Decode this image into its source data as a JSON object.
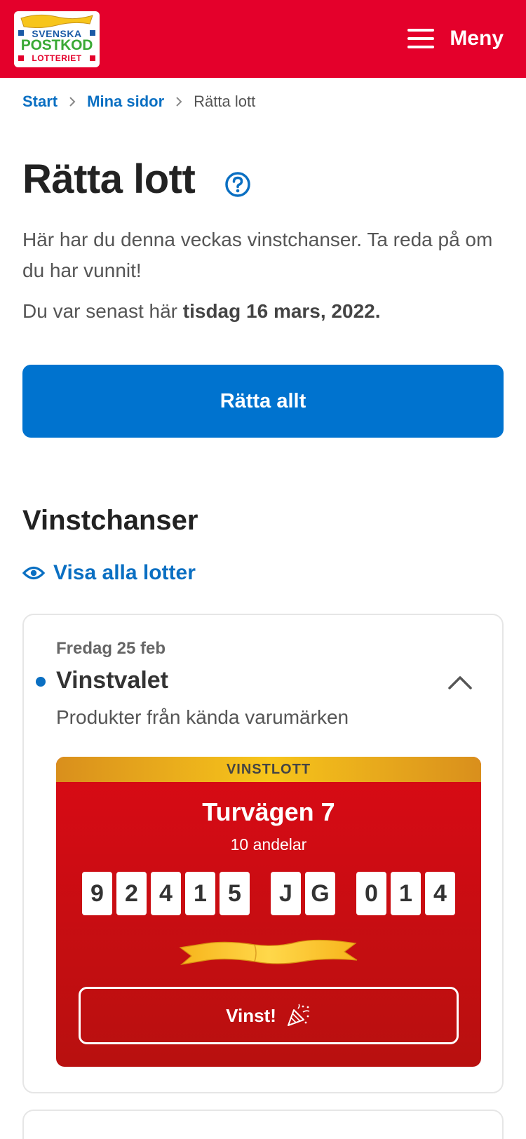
{
  "header": {
    "logo": {
      "line1": "SVENSKA",
      "line2": "POSTKOD",
      "line3": "LOTTERIET"
    },
    "menu_label": "Meny",
    "bg_color": "#e4002b"
  },
  "breadcrumb": {
    "items": [
      "Start",
      "Mina sidor"
    ],
    "current": "Rätta lott"
  },
  "page": {
    "title": "Rätta lott",
    "intro": "Här har du denna veckas vinstchanser. Ta reda på om du har vunnit!",
    "last_visit_prefix": "Du var senast här ",
    "last_visit_date": "tisdag 16 mars, 2022.",
    "primary_button": "Rätta allt"
  },
  "section": {
    "title": "Vinstchanser",
    "show_all": "Visa alla lotter"
  },
  "card": {
    "date": "Fredag 25 feb",
    "title": "Vinstvalet",
    "subtitle": "Produkter från kända varumärken",
    "win": {
      "banner": "VINSTLOTT",
      "address": "Turvägen 7",
      "shares": "10 andelar",
      "code_groups": [
        [
          "9",
          "2",
          "4",
          "1",
          "5"
        ],
        [
          "J",
          "G"
        ],
        [
          "0",
          "1",
          "4"
        ]
      ],
      "button": "Vinst!"
    }
  },
  "colors": {
    "accent": "#0073cf",
    "link": "#0a6fc2",
    "gold": "#f7c51b"
  },
  "icons": [
    "menu-icon",
    "help-icon",
    "eye-icon",
    "chevron-up-icon",
    "party-popper-icon"
  ]
}
